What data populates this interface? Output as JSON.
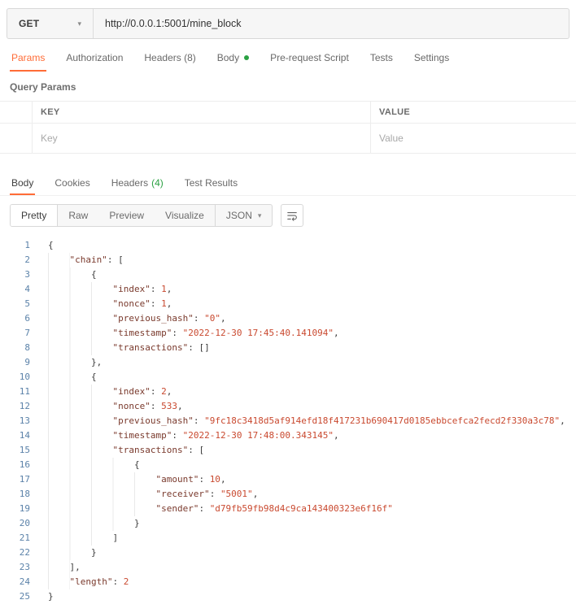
{
  "colors": {
    "accent": "#FF6C37",
    "success": "#2BA143",
    "code-key": "#7A3A2D",
    "code-string": "#C9492F",
    "code-number": "#C9492F",
    "code-punct": "#3C3C3C",
    "line-number": "#5B82A9"
  },
  "request": {
    "method": "GET",
    "url": "http://0.0.0.1:5001/mine_block",
    "tabs": {
      "params": "Params",
      "authorization": "Authorization",
      "headers": "Headers (8)",
      "body": "Body",
      "prerequest": "Pre-request Script",
      "tests": "Tests",
      "settings": "Settings"
    },
    "query_params": {
      "title": "Query Params",
      "columns": {
        "key": "KEY",
        "value": "VALUE"
      },
      "placeholders": {
        "key": "Key",
        "value": "Value"
      }
    }
  },
  "response": {
    "tabs": {
      "body": "Body",
      "cookies": "Cookies",
      "headers": "Headers",
      "headers_count": "(4)",
      "test_results": "Test Results"
    },
    "views": {
      "pretty": "Pretty",
      "raw": "Raw",
      "preview": "Preview",
      "visualize": "Visualize"
    },
    "format": "JSON",
    "code": {
      "lines": [
        {
          "tokens": [
            [
              "p",
              "{"
            ]
          ]
        },
        {
          "indent": 4,
          "tokens": [
            [
              "k",
              "\"chain\""
            ],
            [
              "p",
              ": ["
            ]
          ]
        },
        {
          "indent": 8,
          "tokens": [
            [
              "p",
              "{"
            ]
          ]
        },
        {
          "indent": 12,
          "tokens": [
            [
              "k",
              "\"index\""
            ],
            [
              "p",
              ": "
            ],
            [
              "n",
              "1"
            ],
            [
              "p",
              ","
            ]
          ]
        },
        {
          "indent": 12,
          "tokens": [
            [
              "k",
              "\"nonce\""
            ],
            [
              "p",
              ": "
            ],
            [
              "n",
              "1"
            ],
            [
              "p",
              ","
            ]
          ]
        },
        {
          "indent": 12,
          "tokens": [
            [
              "k",
              "\"previous_hash\""
            ],
            [
              "p",
              ": "
            ],
            [
              "s",
              "\"0\""
            ],
            [
              "p",
              ","
            ]
          ]
        },
        {
          "indent": 12,
          "tokens": [
            [
              "k",
              "\"timestamp\""
            ],
            [
              "p",
              ": "
            ],
            [
              "s",
              "\"2022-12-30 17:45:40.141094\""
            ],
            [
              "p",
              ","
            ]
          ]
        },
        {
          "indent": 12,
          "tokens": [
            [
              "k",
              "\"transactions\""
            ],
            [
              "p",
              ": []"
            ]
          ]
        },
        {
          "indent": 8,
          "tokens": [
            [
              "p",
              "},"
            ]
          ]
        },
        {
          "indent": 8,
          "tokens": [
            [
              "p",
              "{"
            ]
          ]
        },
        {
          "indent": 12,
          "tokens": [
            [
              "k",
              "\"index\""
            ],
            [
              "p",
              ": "
            ],
            [
              "n",
              "2"
            ],
            [
              "p",
              ","
            ]
          ]
        },
        {
          "indent": 12,
          "tokens": [
            [
              "k",
              "\"nonce\""
            ],
            [
              "p",
              ": "
            ],
            [
              "n",
              "533"
            ],
            [
              "p",
              ","
            ]
          ]
        },
        {
          "indent": 12,
          "tokens": [
            [
              "k",
              "\"previous_hash\""
            ],
            [
              "p",
              ": "
            ],
            [
              "s",
              "\"9fc18c3418d5af914efd18f417231b690417d0185ebbcefca2fecd2f330a3c78\""
            ],
            [
              "p",
              ","
            ]
          ]
        },
        {
          "indent": 12,
          "tokens": [
            [
              "k",
              "\"timestamp\""
            ],
            [
              "p",
              ": "
            ],
            [
              "s",
              "\"2022-12-30 17:48:00.343145\""
            ],
            [
              "p",
              ","
            ]
          ]
        },
        {
          "indent": 12,
          "tokens": [
            [
              "k",
              "\"transactions\""
            ],
            [
              "p",
              ": ["
            ]
          ]
        },
        {
          "indent": 16,
          "tokens": [
            [
              "p",
              "{"
            ]
          ]
        },
        {
          "indent": 20,
          "tokens": [
            [
              "k",
              "\"amount\""
            ],
            [
              "p",
              ": "
            ],
            [
              "n",
              "10"
            ],
            [
              "p",
              ","
            ]
          ]
        },
        {
          "indent": 20,
          "tokens": [
            [
              "k",
              "\"receiver\""
            ],
            [
              "p",
              ": "
            ],
            [
              "s",
              "\"5001\""
            ],
            [
              "p",
              ","
            ]
          ]
        },
        {
          "indent": 20,
          "tokens": [
            [
              "k",
              "\"sender\""
            ],
            [
              "p",
              ": "
            ],
            [
              "s",
              "\"d79fb59fb98d4c9ca143400323e6f16f\""
            ]
          ]
        },
        {
          "indent": 16,
          "tokens": [
            [
              "p",
              "}"
            ]
          ]
        },
        {
          "indent": 12,
          "tokens": [
            [
              "p",
              "]"
            ]
          ]
        },
        {
          "indent": 8,
          "tokens": [
            [
              "p",
              "}"
            ]
          ]
        },
        {
          "indent": 4,
          "tokens": [
            [
              "p",
              "],"
            ]
          ]
        },
        {
          "indent": 4,
          "tokens": [
            [
              "k",
              "\"length\""
            ],
            [
              "p",
              ": "
            ],
            [
              "n",
              "2"
            ]
          ]
        },
        {
          "tokens": [
            [
              "p",
              "}"
            ]
          ]
        }
      ]
    }
  }
}
